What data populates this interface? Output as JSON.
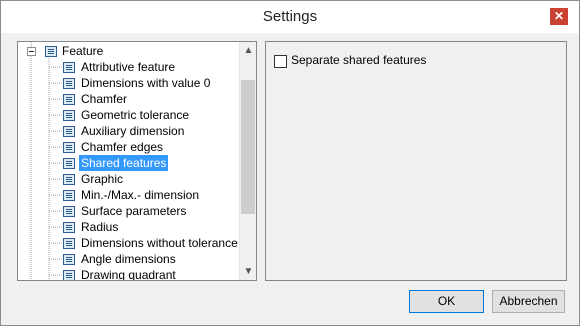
{
  "window": {
    "title": "Settings"
  },
  "tree": {
    "root": {
      "label": "Feature"
    },
    "items": [
      {
        "label": "Attributive feature",
        "selected": false
      },
      {
        "label": "Dimensions with value 0",
        "selected": false
      },
      {
        "label": "Chamfer",
        "selected": false
      },
      {
        "label": "Geometric tolerance",
        "selected": false
      },
      {
        "label": "Auxiliary dimension",
        "selected": false
      },
      {
        "label": "Chamfer edges",
        "selected": false
      },
      {
        "label": "Shared features",
        "selected": true
      },
      {
        "label": "Graphic",
        "selected": false
      },
      {
        "label": "Min.-/Max.- dimension",
        "selected": false
      },
      {
        "label": "Surface parameters",
        "selected": false
      },
      {
        "label": "Radius",
        "selected": false
      },
      {
        "label": "Dimensions without tolerance",
        "selected": false
      },
      {
        "label": "Angle dimensions",
        "selected": false
      },
      {
        "label": "Drawing quadrant",
        "selected": false
      }
    ]
  },
  "options": {
    "separate_shared": {
      "label": "Separate shared features",
      "checked": false
    }
  },
  "buttons": {
    "ok": "OK",
    "cancel": "Abbrechen"
  },
  "colors": {
    "selection": "#3399ff",
    "close": "#c94234"
  }
}
